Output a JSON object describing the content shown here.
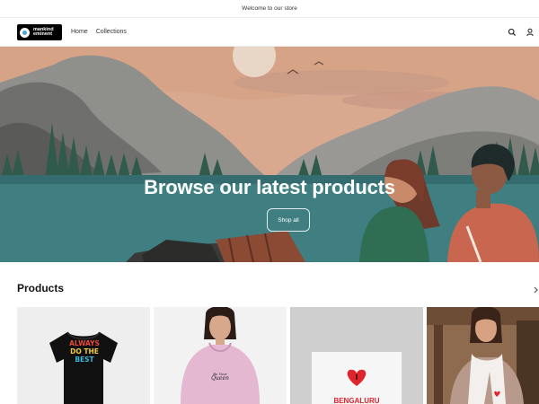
{
  "announcement": "Welcome to our store",
  "header": {
    "logo_line1": "mankind",
    "logo_line2": "eminent",
    "nav": [
      "Home",
      "Collections"
    ]
  },
  "hero": {
    "title": "Browse our latest products",
    "button": "Shop all"
  },
  "products": {
    "title": "Products",
    "items": [
      {
        "image": "black t-shirt",
        "print": [
          "ALWAYS",
          "DO THE",
          "BEST"
        ]
      },
      {
        "image": "pink hoodie",
        "print": [
          "Be Your",
          "Queen"
        ]
      },
      {
        "image": "white tote bag",
        "print": [
          "I",
          "BENGALURU"
        ]
      },
      {
        "image": "woman wearing scarf",
        "print": []
      }
    ]
  },
  "colors": {
    "text": "#121212",
    "border": "#ececec",
    "hero_teal": "#3f7f82"
  },
  "icons": {
    "search": "search-icon",
    "account": "account-icon"
  }
}
